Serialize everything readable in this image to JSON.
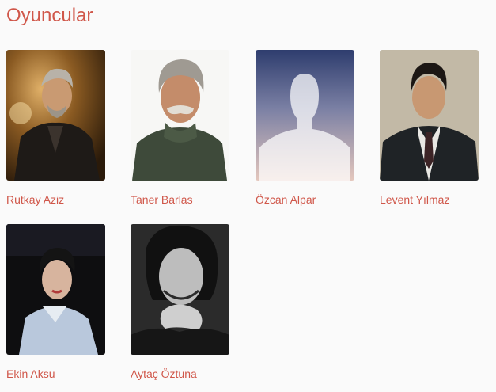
{
  "section": {
    "title": "Oyuncular"
  },
  "cast": [
    {
      "name": "Rutkay Aziz",
      "photo": "actor-photo"
    },
    {
      "name": "Taner Barlas",
      "photo": "actor-photo"
    },
    {
      "name": "Özcan Alpar",
      "photo": "placeholder-avatar-icon"
    },
    {
      "name": "Levent Yılmaz",
      "photo": "actor-photo"
    },
    {
      "name": "Ekin Aksu",
      "photo": "actor-photo"
    },
    {
      "name": "Aytaç Öztuna",
      "photo": "actor-photo"
    }
  ],
  "colors": {
    "accent": "#d0574a",
    "background": "#fafafa"
  }
}
